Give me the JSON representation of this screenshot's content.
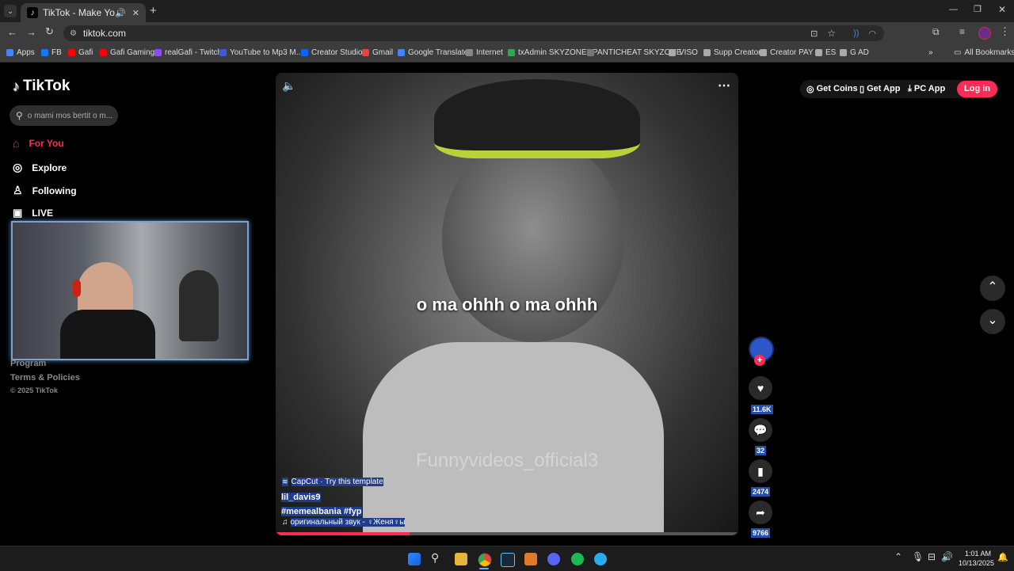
{
  "browser": {
    "tab_title": "TikTok - Make Your Day",
    "url": "tiktok.com",
    "bookmarks": [
      {
        "label": "Apps",
        "color": "#4285f4"
      },
      {
        "label": "FB",
        "color": "#1877f2"
      },
      {
        "label": "Gafi",
        "color": "#ff0000"
      },
      {
        "label": "Gafi Gaming",
        "color": "#ff0000"
      },
      {
        "label": "realGafi - Twitch",
        "color": "#9146ff"
      },
      {
        "label": "YouTube to Mp3 M...",
        "color": "#3b5bdb"
      },
      {
        "label": "Creator Studio",
        "color": "#0866ff"
      },
      {
        "label": "Gmail",
        "color": "#ea4335"
      },
      {
        "label": "Google Translate",
        "color": "#4285f4"
      },
      {
        "label": "Internet",
        "color": "#888888"
      },
      {
        "label": "txAdmin SKYZONERP",
        "color": "#2fa84f"
      },
      {
        "label": "ANTICHEAT SKYZONE",
        "color": "#777777"
      },
      {
        "label": "VISO",
        "color": "#aaaaaa"
      },
      {
        "label": "Supp Creator",
        "color": "#aaaaaa"
      },
      {
        "label": "Creator PAY",
        "color": "#aaaaaa"
      },
      {
        "label": "ES",
        "color": "#aaaaaa"
      },
      {
        "label": "G AD",
        "color": "#aaaaaa"
      }
    ],
    "all_bookmarks": "All Bookmarks"
  },
  "tiktok": {
    "logo": "TikTok",
    "search_placeholder": "o mami mos bertit o m...",
    "nav": [
      "For You",
      "Explore",
      "Following",
      "LIVE"
    ],
    "footer": [
      "Program",
      "Terms & Policies",
      "© 2025 TikTok"
    ],
    "header_buttons": {
      "coins": "Get Coins",
      "app": "Get App",
      "pc": "PC App",
      "login": "Log in"
    },
    "accent": "#fe2c55",
    "video": {
      "caption": "o ma ohhh o ma ohhh",
      "watermark": "Funnyvideos_official3",
      "capcut": "CapCut · Try this template",
      "author": "lil_davis9",
      "tags": "#memealbania  #fyp",
      "sound": "оригинальный звук - ♀Женя♀ы",
      "progress": 0.29
    },
    "actions": {
      "likes": "11.6K",
      "comments": "32",
      "saves": "2474",
      "shares": "9766"
    }
  },
  "taskbar": {
    "time": "1:01 AM",
    "date": "10/13/2025"
  }
}
